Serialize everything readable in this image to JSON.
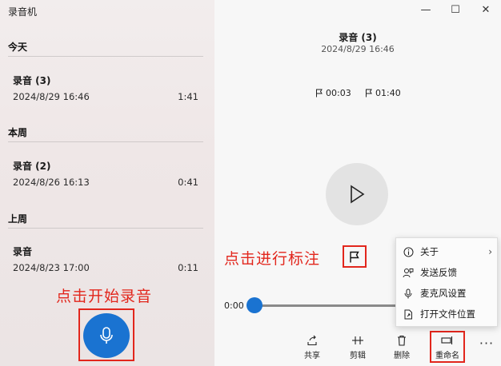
{
  "app": {
    "title": "录音机"
  },
  "sections": [
    {
      "label": "今天",
      "recordings": [
        {
          "name": "录音 (3)",
          "date": "2024/8/29 16:46",
          "duration": "1:41"
        }
      ]
    },
    {
      "label": "本周",
      "recordings": [
        {
          "name": "录音 (2)",
          "date": "2024/8/26 16:13",
          "duration": "0:41"
        }
      ]
    },
    {
      "label": "上周",
      "recordings": [
        {
          "name": "录音",
          "date": "2024/8/23 17:00",
          "duration": "0:11"
        }
      ]
    }
  ],
  "window_controls": {
    "minimize": "—",
    "maximize": "☐",
    "close": "✕"
  },
  "player": {
    "title": "录音 (3)",
    "date": "2024/8/29 16:46",
    "markers": [
      "00:03",
      "01:40"
    ],
    "current_time": "0:00",
    "progress": 0
  },
  "annotations": {
    "start_recording": "点击开始录音",
    "add_marker": "点击进行标注"
  },
  "toolbar": {
    "share": "共享",
    "trim": "剪辑",
    "delete": "删除",
    "rename": "重命名",
    "more": "···"
  },
  "menu": {
    "about": "关于",
    "feedback": "发送反馈",
    "mic_settings": "麦克风设置",
    "open_location": "打开文件位置"
  },
  "colors": {
    "accent": "#1a73d1",
    "annotation": "#e2261c"
  }
}
